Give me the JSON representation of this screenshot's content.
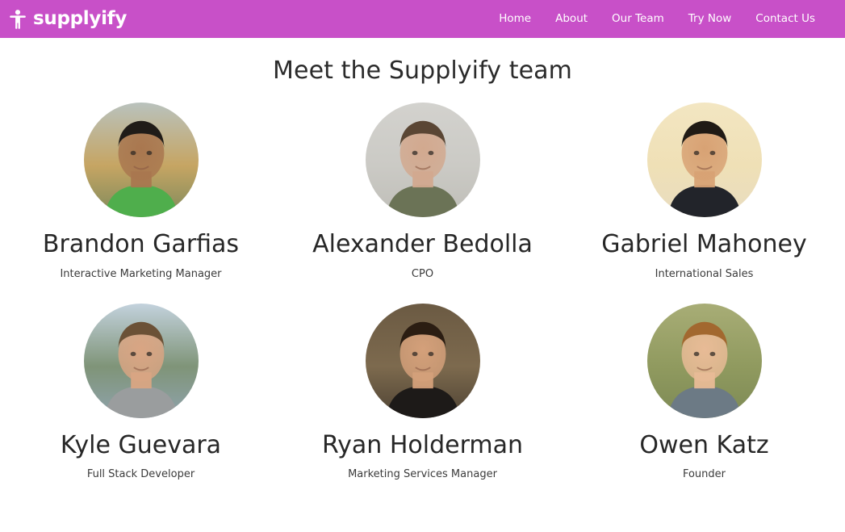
{
  "theme": {
    "navbar_bg": "#c850c8",
    "navbar_text": "#ffffff",
    "page_bg": "#ffffff",
    "heading_color": "#2b2b2b"
  },
  "navbar": {
    "brand_label": "supplyify",
    "brand_icon": "child-icon",
    "links": [
      {
        "label": "Home"
      },
      {
        "label": "About"
      },
      {
        "label": "Our Team"
      },
      {
        "label": "Try Now"
      },
      {
        "label": "Contact Us"
      }
    ]
  },
  "main": {
    "heading": "Meet the Supplyify team",
    "team": [
      {
        "name": "Brandon Garfias",
        "role": "Interactive Marketing Manager",
        "avatar": "photo-man-sunglasses-outdoors",
        "colors": {
          "bg_top": "#b9c2bd",
          "bg_mid": "#c6a563",
          "bg_bottom": "#7e8a5c",
          "hair": "#201c18",
          "skin": "#a9774f",
          "shirt": "#4fae4c"
        }
      },
      {
        "name": "Alexander Bedolla",
        "role": "CPO",
        "avatar": "photo-man-long-hair-grey-wall",
        "colors": {
          "bg_top": "#d3d2ce",
          "bg_mid": "#cbcac5",
          "bg_bottom": "#bfbeb8",
          "hair": "#5a4634",
          "skin": "#d2a98f",
          "shirt": "#6b7356"
        }
      },
      {
        "name": "Gabriel Mahoney",
        "role": "International Sales",
        "avatar": "photo-young-man-cream-wall",
        "colors": {
          "bg_top": "#f3e6c2",
          "bg_mid": "#efe0b6",
          "bg_bottom": "#e8dcc0",
          "hair": "#201a15",
          "skin": "#d8a274",
          "shirt": "#22242a"
        }
      },
      {
        "name": "Kyle Guevara",
        "role": "Full Stack Developer",
        "avatar": "photo-man-lake-background",
        "colors": {
          "bg_top": "#c3d2dd",
          "bg_mid": "#7f9478",
          "bg_bottom": "#8fa3ad",
          "hair": "#6b5136",
          "skin": "#d9a583",
          "shirt": "#9a9d9e"
        }
      },
      {
        "name": "Ryan Holderman",
        "role": "Marketing Services Manager",
        "avatar": "photo-man-suit-red-tie-studio",
        "colors": {
          "bg_top": "#6b5a43",
          "bg_mid": "#7d6a4e",
          "bg_bottom": "#4e4334",
          "hair": "#2b1d12",
          "skin": "#d4a07a",
          "shirt": "#1d1a18"
        }
      },
      {
        "name": "Owen Katz",
        "role": "Founder",
        "avatar": "photo-man-sunglasses-hillside",
        "colors": {
          "bg_top": "#a8ad76",
          "bg_mid": "#909a5f",
          "bg_bottom": "#7d8a55",
          "hair": "#a2682f",
          "skin": "#e8bb96",
          "shirt": "#6c7a85"
        }
      }
    ]
  }
}
